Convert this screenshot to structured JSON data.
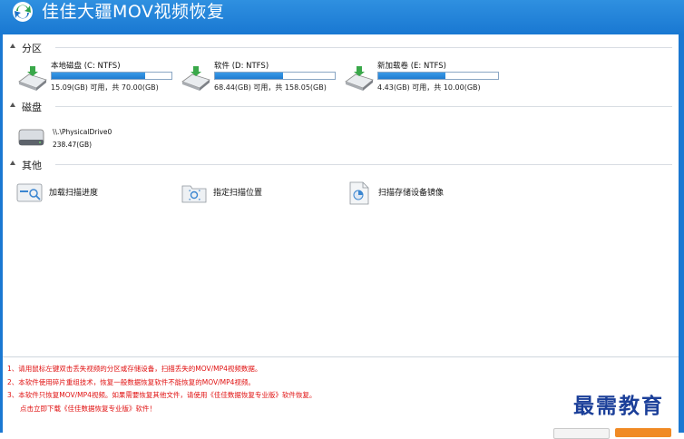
{
  "app": {
    "title": "佳佳大疆MOV视频恢复"
  },
  "sections": {
    "partition": "分区",
    "disk": "磁盘",
    "other": "其他"
  },
  "partitions": [
    {
      "name": "本地磁盘 (C: NTFS)",
      "info": "15.09(GB) 可用，共 70.00(GB)",
      "used_fraction": 0.78
    },
    {
      "name": "软件 (D: NTFS)",
      "info": "68.44(GB) 可用，共 158.05(GB)",
      "used_fraction": 0.57
    },
    {
      "name": "新加载卷 (E: NTFS)",
      "info": "4.43(GB) 可用，共 10.00(GB)",
      "used_fraction": 0.56
    }
  ],
  "disks": [
    {
      "name": "\\\\.\\PhysicalDrive0",
      "size": "238.47(GB)"
    }
  ],
  "other_actions": [
    {
      "label": "加载扫描进度",
      "icon": "load-progress-icon"
    },
    {
      "label": "指定扫描位置",
      "icon": "folder-scan-icon"
    },
    {
      "label": "扫描存储设备镜像",
      "icon": "disk-image-icon"
    }
  ],
  "notes": [
    "1、请用鼠标左键双击丢失视频的分区或存储设备，扫描丢失的MOV/MP4视频数据。",
    "2、本软件使用碎片重组技术，恢复一般数据恢复软件不能恢复的MOV/MP4视频。",
    "3、本软件只恢复MOV/MP4视频。如果需要恢复其他文件，请使用《佳佳数据恢复专业版》软件恢复。",
    "点击立即下载《佳佳数据恢复专业版》软件！"
  ],
  "watermark": "最需教育",
  "colors": {
    "titlebar": "#1978d2",
    "progress": "#1f7ccf",
    "notes": "#e01010"
  }
}
